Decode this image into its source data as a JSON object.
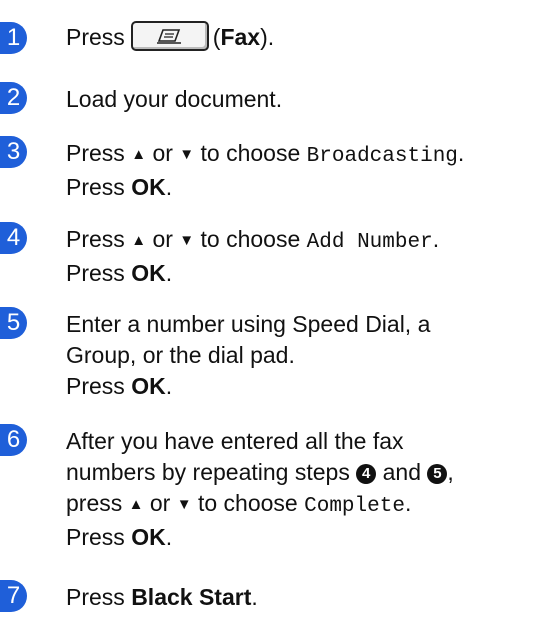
{
  "steps": [
    {
      "num": "1",
      "press": "Press",
      "paren_open": "(",
      "fax": "Fax",
      "paren_close": ")."
    },
    {
      "num": "2",
      "text": "Load your document."
    },
    {
      "num": "3",
      "press": "Press",
      "up": "▲",
      "or": "or",
      "down": "▼",
      "choose": "to choose",
      "option": "Broadcasting",
      "period": ".",
      "press2": "Press",
      "ok": "OK"
    },
    {
      "num": "4",
      "press": "Press",
      "up": "▲",
      "or": "or",
      "down": "▼",
      "choose": "to choose",
      "option": "Add Number",
      "period": ".",
      "press2": "Press",
      "ok": "OK"
    },
    {
      "num": "5",
      "line1": "Enter a number using Speed Dial, a",
      "line2": "Group, or the dial pad.",
      "press2": "Press",
      "ok": "OK"
    },
    {
      "num": "6",
      "line1": "After you have entered all the fax",
      "line2a": "numbers by repeating steps",
      "ref1": "4",
      "and": "and",
      "ref2": "5",
      "press": "press",
      "up": "▲",
      "or": "or",
      "down": "▼",
      "choose": "to choose",
      "option": "Complete",
      "period": ".",
      "press2": "Press",
      "ok": "OK"
    },
    {
      "num": "7",
      "press": "Press",
      "key": "Black Start"
    }
  ]
}
